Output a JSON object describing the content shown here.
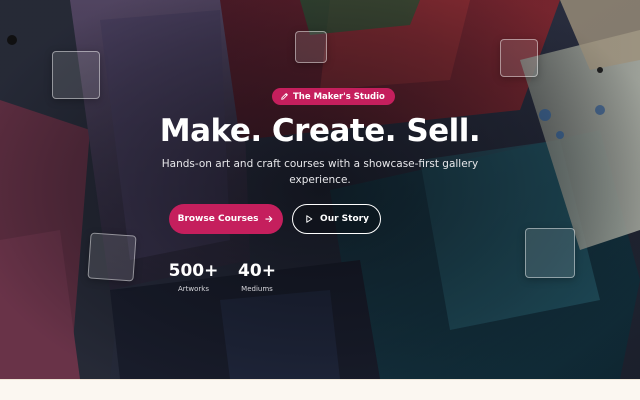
{
  "hero": {
    "badge": {
      "icon": "pencil-icon",
      "label": "The Maker's Studio"
    },
    "title": "Make. Create. Sell.",
    "subtitle": "Hands-on art and craft courses with a showcase-first gallery experience.",
    "primary_button": {
      "label": "Browse Courses",
      "icon": "arrow-right-icon"
    },
    "secondary_button": {
      "label": "Our Story",
      "icon": "play-icon"
    },
    "stats": [
      {
        "value": "500+",
        "label": "Artworks"
      },
      {
        "value": "40+",
        "label": "Mediums"
      }
    ]
  },
  "colors": {
    "accent": "#c51f5d",
    "text": "#ffffff",
    "bottom_strip": "#fbf7f1"
  }
}
